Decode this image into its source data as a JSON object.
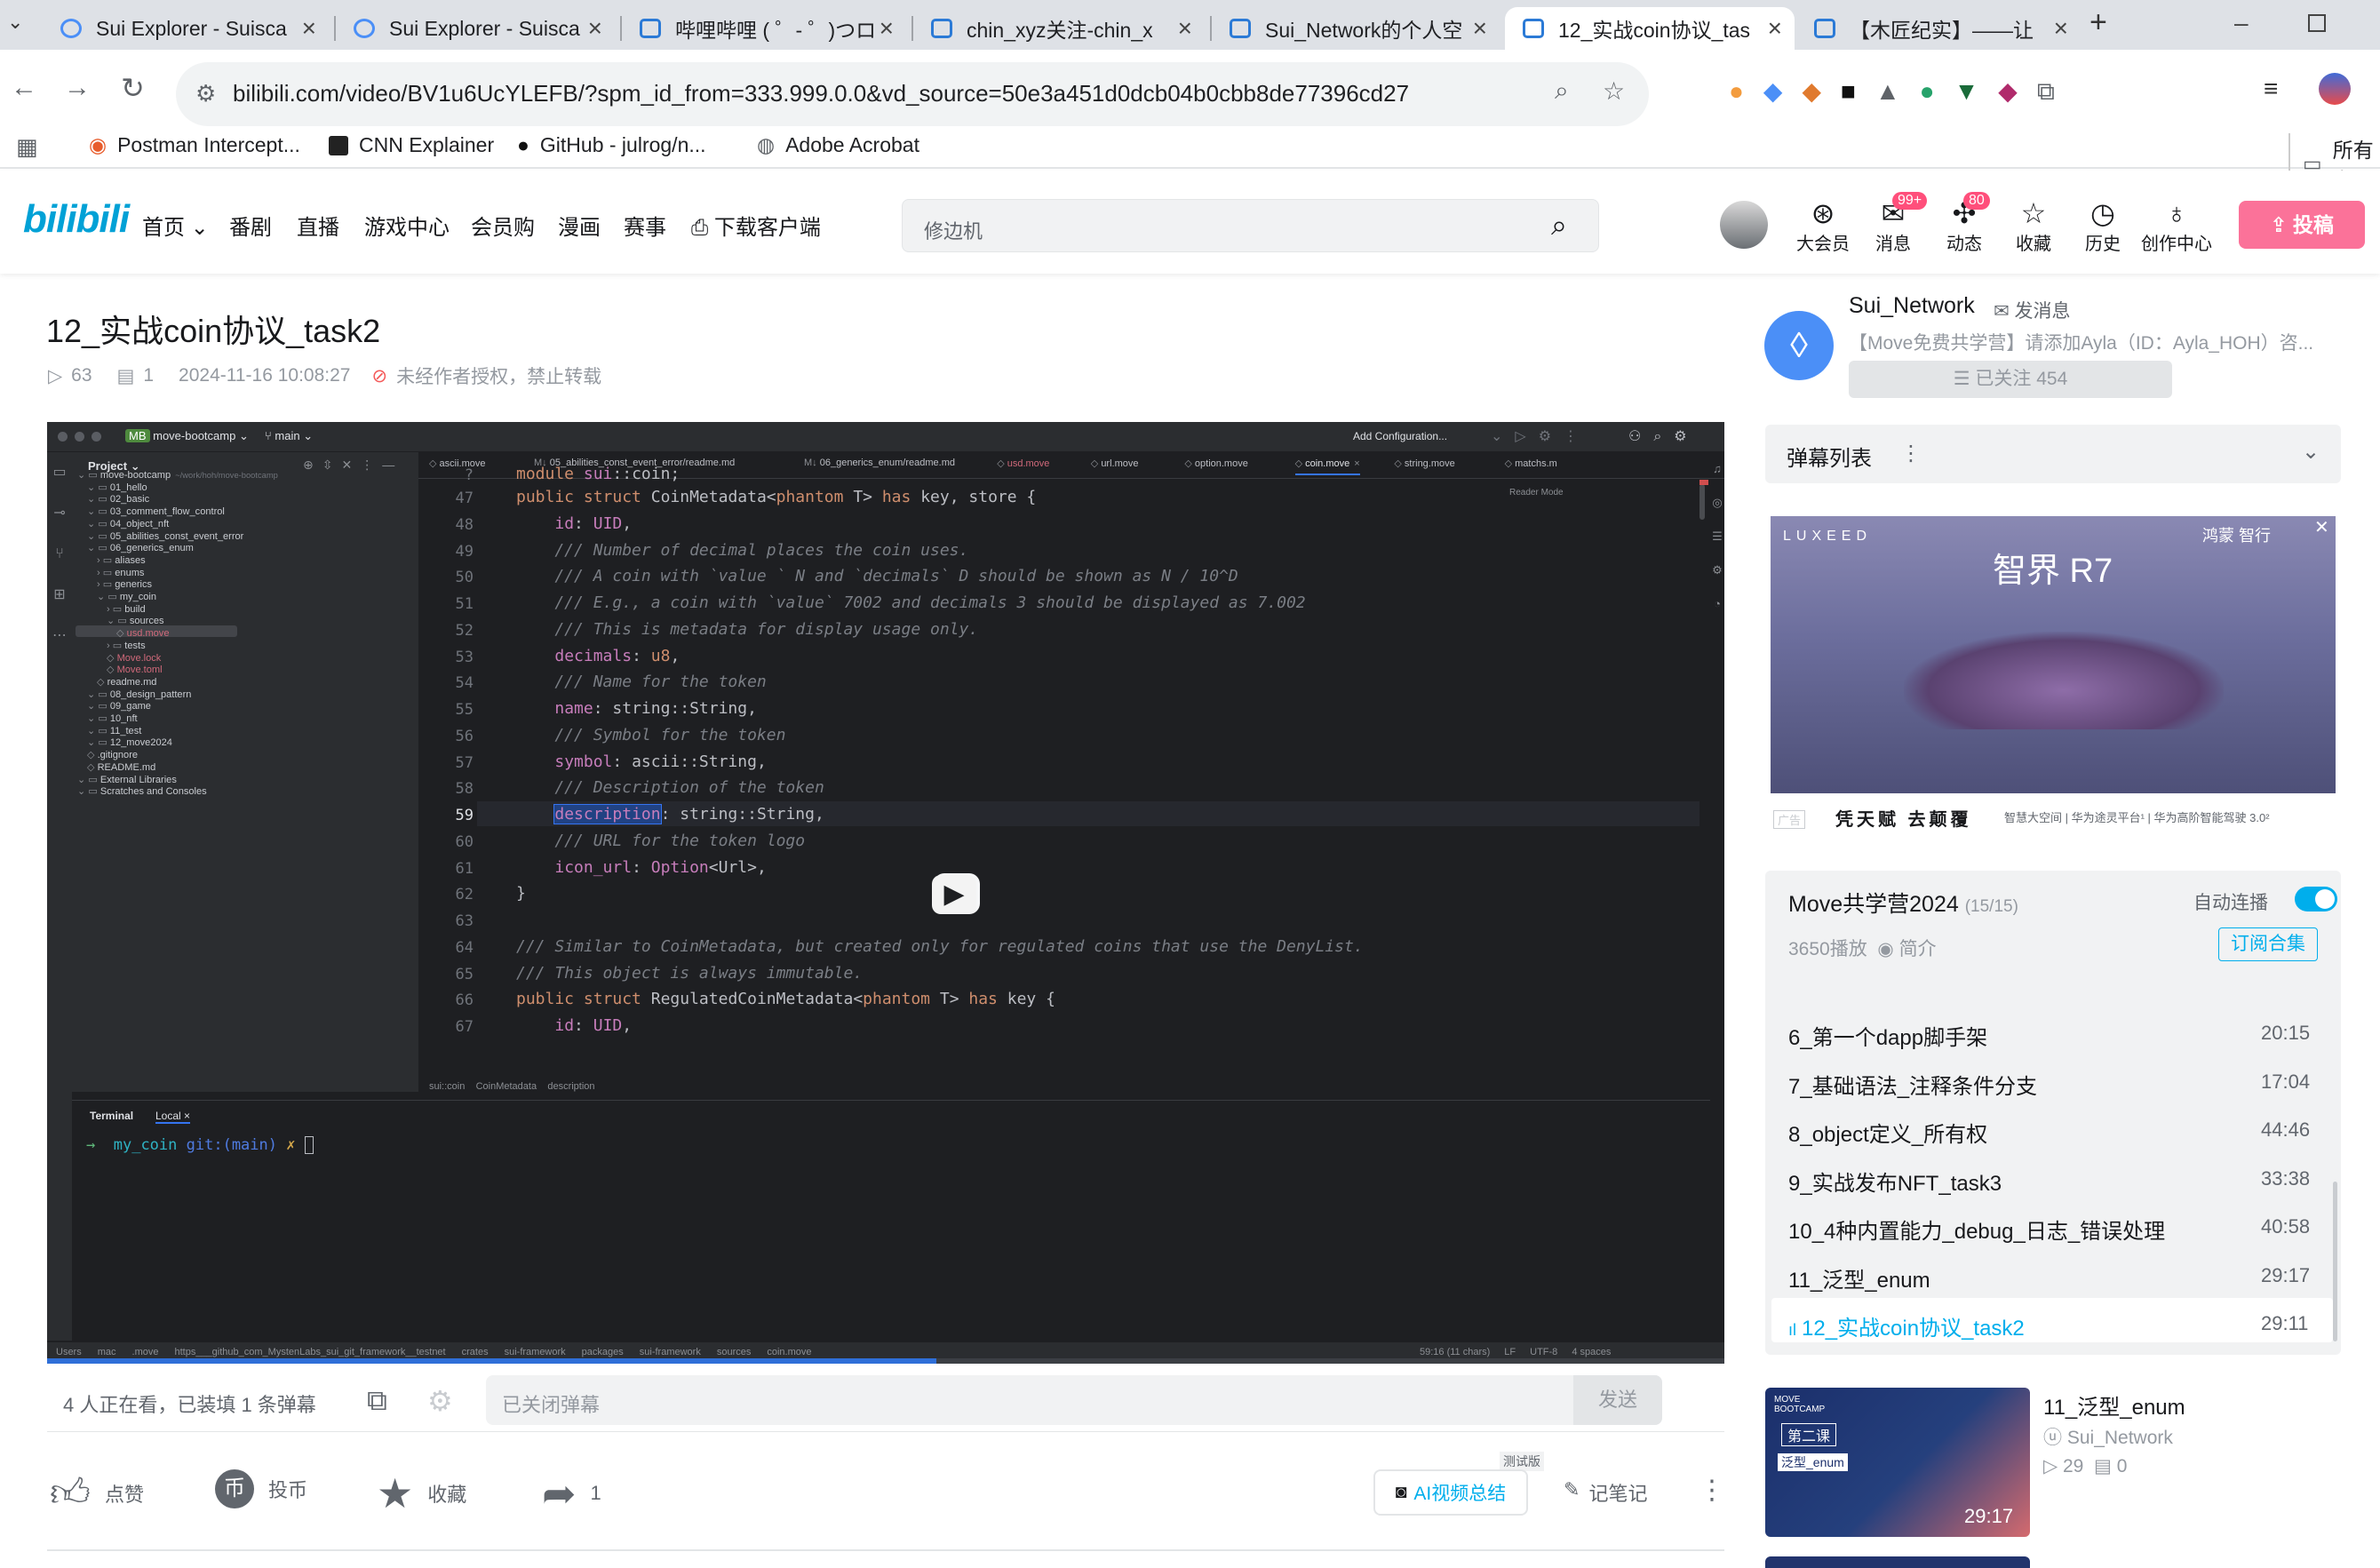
{
  "browser": {
    "tabs": [
      {
        "title": "Sui Explorer - Suisca"
      },
      {
        "title": "Sui Explorer - Suisca"
      },
      {
        "title": "哔哩哔哩 ( ゜- ゜)つロ"
      },
      {
        "title": "chin_xyz关注-chin_x"
      },
      {
        "title": "Sui_Network的个人空"
      },
      {
        "title": "12_实战coin协议_tas"
      },
      {
        "title": "【木匠纪实】——让"
      }
    ],
    "url": "bilibili.com/video/BV1u6UcYLEFB/?spm_id_from=333.999.0.0&vd_source=50e3a451d0dcb04b0cbb8de77396cd27",
    "bookmarks": [
      "Postman Intercept...",
      "CNN Explainer",
      "GitHub - julrog/n...",
      "Adobe Acrobat"
    ],
    "all_bookmarks": "所有书"
  },
  "header": {
    "logo": "bilibili",
    "nav": [
      "首页",
      "番剧",
      "直播",
      "游戏中心",
      "会员购",
      "漫画",
      "赛事",
      "下载客户端"
    ],
    "search_placeholder": "修边机",
    "icons": [
      {
        "label": "大会员",
        "icon": "vip-icon"
      },
      {
        "label": "消息",
        "icon": "message-icon",
        "badge": "99+"
      },
      {
        "label": "动态",
        "icon": "feed-icon",
        "badge": "80"
      },
      {
        "label": "收藏",
        "icon": "star-icon"
      },
      {
        "label": "历史",
        "icon": "clock-icon"
      },
      {
        "label": "创作中心",
        "icon": "bulb-icon"
      }
    ],
    "upload": "投稿"
  },
  "video": {
    "title": "12_实战coin协议_task2",
    "views": "63",
    "danmaku_count": "1",
    "date": "2024-11-16 10:08:27",
    "notice": "未经作者授权，禁止转载",
    "watching": "4 人正在看，已装填 1 条弹幕",
    "danmaku_placeholder": "已关闭弹幕",
    "send": "发送",
    "actions": {
      "like": "点赞",
      "coin": "投币",
      "fav": "收藏",
      "share": "1"
    },
    "ai_tag": "测试版",
    "ai_summary": "AI视频总结",
    "notes": "记笔记"
  },
  "ide": {
    "project": "move-bootcamp",
    "branch": "main",
    "run_config": "Add Configuration...",
    "tabs": [
      "ascii.move",
      "05_abilities_const_event_error/readme.md",
      "06_generics_enum/readme.md",
      "usd.move",
      "url.move",
      "option.move",
      "coin.move",
      "string.move",
      "matchs.m"
    ],
    "panel_title": "Project",
    "tree": [
      {
        "name": "move-bootcamp",
        "hint": "~/work/hoh/move-bootcamp",
        "depth": 0
      },
      {
        "name": "01_hello",
        "depth": 1
      },
      {
        "name": "02_basic",
        "depth": 1
      },
      {
        "name": "03_comment_flow_control",
        "depth": 1
      },
      {
        "name": "04_object_nft",
        "depth": 1
      },
      {
        "name": "05_abilities_const_event_error",
        "depth": 1
      },
      {
        "name": "06_generics_enum",
        "depth": 1
      },
      {
        "name": "aliases",
        "depth": 2
      },
      {
        "name": "enums",
        "depth": 2
      },
      {
        "name": "generics",
        "depth": 2
      },
      {
        "name": "my_coin",
        "depth": 2
      },
      {
        "name": "build",
        "depth": 3
      },
      {
        "name": "sources",
        "depth": 3
      },
      {
        "name": "usd.move",
        "depth": 4
      },
      {
        "name": "tests",
        "depth": 3
      },
      {
        "name": "Move.lock",
        "depth": 3
      },
      {
        "name": "Move.toml",
        "depth": 3
      },
      {
        "name": "readme.md",
        "depth": 2
      },
      {
        "name": "08_design_pattern",
        "depth": 1
      },
      {
        "name": "09_game",
        "depth": 1
      },
      {
        "name": "10_nft",
        "depth": 1
      },
      {
        "name": "11_test",
        "depth": 1
      },
      {
        "name": "12_move2024",
        "depth": 1
      },
      {
        "name": ".gitignore",
        "depth": 1
      },
      {
        "name": "README.md",
        "depth": 1
      },
      {
        "name": "External Libraries",
        "depth": 0
      },
      {
        "name": "Scratches and Consoles",
        "depth": 0
      }
    ],
    "reader_mode": "Reader Mode",
    "code": [
      {
        "n": "?",
        "t": "module sui::coin;"
      },
      {
        "n": "47",
        "t": "public struct CoinMetadata<phantom T> has key, store {"
      },
      {
        "n": "48",
        "t": "    id: UID,"
      },
      {
        "n": "49",
        "t": "    /// Number of decimal places the coin uses."
      },
      {
        "n": "50",
        "t": "    /// A coin with `value ` N and `decimals` D should be shown as N / 10^D"
      },
      {
        "n": "51",
        "t": "    /// E.g., a coin with `value` 7002 and decimals 3 should be displayed as 7.002"
      },
      {
        "n": "52",
        "t": "    /// This is metadata for display usage only."
      },
      {
        "n": "53",
        "t": "    decimals: u8,"
      },
      {
        "n": "54",
        "t": "    /// Name for the token"
      },
      {
        "n": "55",
        "t": "    name: string::String,"
      },
      {
        "n": "56",
        "t": "    /// Symbol for the token"
      },
      {
        "n": "57",
        "t": "    symbol: ascii::String,"
      },
      {
        "n": "58",
        "t": "    /// Description of the token"
      },
      {
        "n": "59",
        "t": "    description: string::String,"
      },
      {
        "n": "60",
        "t": "    /// URL for the token logo"
      },
      {
        "n": "61",
        "t": "    icon_url: Option<Url>,"
      },
      {
        "n": "62",
        "t": "}"
      },
      {
        "n": "63",
        "t": ""
      },
      {
        "n": "64",
        "t": "/// Similar to CoinMetadata, but created only for regulated coins that use the DenyList."
      },
      {
        "n": "65",
        "t": "/// This object is always immutable."
      },
      {
        "n": "66",
        "t": "public struct RegulatedCoinMetadata<phantom T> has key {"
      },
      {
        "n": "67",
        "t": "    id: UID,"
      }
    ],
    "breadcrumb": [
      "sui::coin",
      "CoinMetadata",
      "description"
    ],
    "terminal_tabs": [
      "Terminal",
      "Local"
    ],
    "prompt_dir": "my_coin",
    "prompt_git": "git:(main)",
    "status_path": [
      "Users",
      "mac",
      ".move",
      "https___github_com_MystenLabs_sui_git_framework__testnet",
      "crates",
      "sui-framework",
      "packages",
      "sui-framework",
      "sources",
      "coin.move"
    ],
    "status_right": [
      "59:16 (11 chars)",
      "LF",
      "UTF-8",
      "4 spaces"
    ]
  },
  "up": {
    "name": "Sui_Network",
    "message": "发消息",
    "desc": "【Move免费共学营】请添加Ayla（ID：Ayla_HOH）咨...",
    "follow": "已关注 454"
  },
  "danmaku_list": "弹幕列表",
  "ad": {
    "brand": "LUXEED",
    "model": "智界 R7",
    "partner": "鸿蒙 智行",
    "tag": "广告",
    "slogan": "凭天赋  去颠覆",
    "fine": "智慧大空间 | 华为途灵平台¹ | 华为高阶智能驾驶 3.0²"
  },
  "playlist": {
    "title": "Move共学营2024",
    "count": "(15/15)",
    "autoplay": "自动连播",
    "plays": "3650播放",
    "intro": "简介",
    "subscribe": "订阅合集",
    "items": [
      {
        "title": "6_第一个dapp脚手架",
        "duration": "20:15"
      },
      {
        "title": "7_基础语法_注释条件分支",
        "duration": "17:04"
      },
      {
        "title": "8_object定义_所有权",
        "duration": "44:46"
      },
      {
        "title": "9_实战发布NFT_task3",
        "duration": "33:38"
      },
      {
        "title": "10_4种内置能力_debug_日志_错误处理",
        "duration": "40:58"
      },
      {
        "title": "11_泛型_enum",
        "duration": "29:17"
      },
      {
        "title": "12_实战coin协议_task2",
        "duration": "29:11"
      }
    ]
  },
  "recommend": {
    "title": "11_泛型_enum",
    "author": "Sui_Network",
    "views": "29",
    "danmaku": "0",
    "duration": "29:17",
    "thumb_top": "MOVE BOOTCAMP",
    "thumb_lesson": "第二课",
    "thumb_topic": "泛型_enum"
  },
  "colors": {
    "accent": "#00aeec",
    "pink": "#fb7299",
    "brand": "#00a1d6"
  }
}
